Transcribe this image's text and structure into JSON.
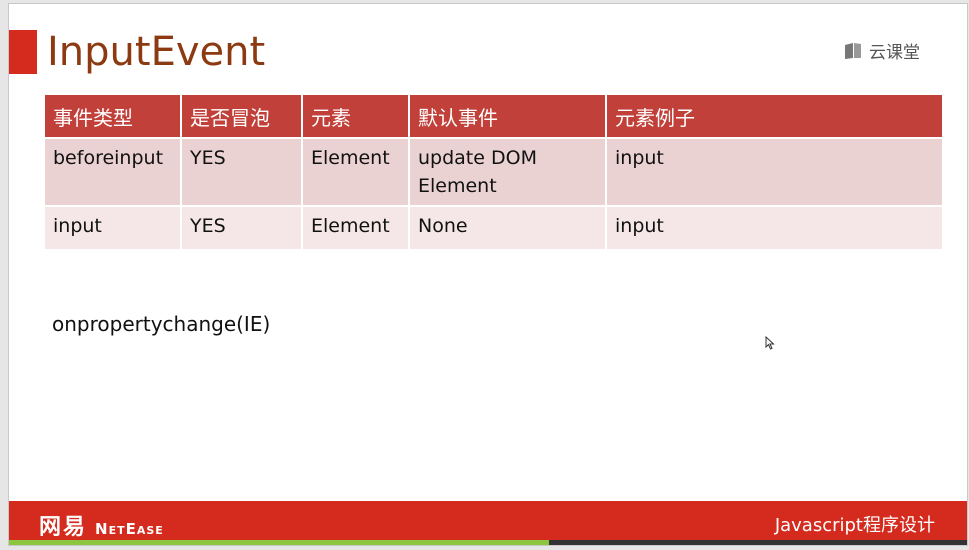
{
  "slide": {
    "title": "InputEvent",
    "logo": {
      "icon": "book-icon",
      "text": "云课堂"
    }
  },
  "table": {
    "headers": [
      "事件类型",
      "是否冒泡",
      "元素",
      "默认事件",
      "元素例子"
    ],
    "rows": [
      [
        "beforeinput",
        "YES",
        "Element",
        "update DOM Element",
        "input"
      ],
      [
        "input",
        "YES",
        "Element",
        "None",
        "input"
      ]
    ]
  },
  "note": "onpropertychange(IE)",
  "footer": {
    "brand_cn": "网易",
    "brand_en": "NetEase",
    "course": "Javascript程序设计"
  },
  "colors": {
    "accent": "#d42b1e",
    "header_bg": "#c1403a",
    "title_color": "#8c3a12",
    "row1_bg": "#ebd2d2",
    "row2_bg": "#f5e7e7",
    "footer_green": "#8cc63f"
  }
}
